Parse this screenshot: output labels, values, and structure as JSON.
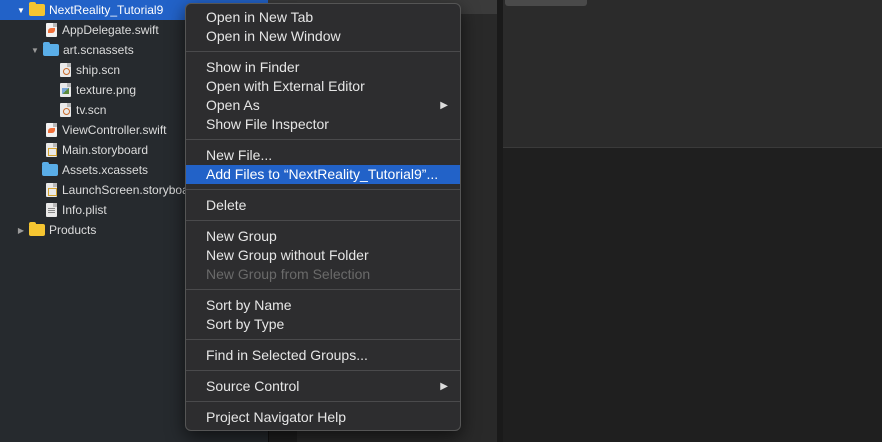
{
  "navigator": {
    "rows": [
      {
        "label": "NextReality_Tutorial9",
        "icon": "folder-icon",
        "disclosure": "open",
        "selected": true
      },
      {
        "label": "AppDelegate.swift",
        "icon": "swift-file-icon"
      },
      {
        "label": "art.scnassets",
        "icon": "blue-folder-icon",
        "disclosure": "open"
      },
      {
        "label": "ship.scn",
        "icon": "scn-file-icon"
      },
      {
        "label": "texture.png",
        "icon": "png-file-icon"
      },
      {
        "label": "tv.scn",
        "icon": "scn-file-icon"
      },
      {
        "label": "ViewController.swift",
        "icon": "swift-file-icon"
      },
      {
        "label": "Main.storyboard",
        "icon": "storyboard-file-icon"
      },
      {
        "label": "Assets.xcassets",
        "icon": "blue-folder-icon"
      },
      {
        "label": "LaunchScreen.storyboard",
        "icon": "storyboard-file-icon"
      },
      {
        "label": "Info.plist",
        "icon": "plist-file-icon"
      },
      {
        "label": "Products",
        "icon": "folder-icon",
        "disclosure": "closed"
      }
    ]
  },
  "context_menu": {
    "open_in_new_tab": "Open in New Tab",
    "open_in_new_window": "Open in New Window",
    "show_in_finder": "Show in Finder",
    "open_with_external_editor": "Open with External Editor",
    "open_as": "Open As",
    "show_file_inspector": "Show File Inspector",
    "new_file": "New File...",
    "add_files": "Add Files to “NextReality_Tutorial9”...",
    "delete": "Delete",
    "new_group": "New Group",
    "new_group_without_folder": "New Group without Folder",
    "new_group_from_selection": "New Group from Selection",
    "sort_by_name": "Sort by Name",
    "sort_by_type": "Sort by Type",
    "find_in_selected_groups": "Find in Selected Groups...",
    "source_control": "Source Control",
    "project_navigator_help": "Project Navigator Help",
    "submenu_arrow": "▶"
  },
  "colors": {
    "selection": "#2262c8",
    "menu_background": "#2d2d2f",
    "navigator_background": "#262a2e",
    "disabled_text": "#6a6a6a"
  }
}
